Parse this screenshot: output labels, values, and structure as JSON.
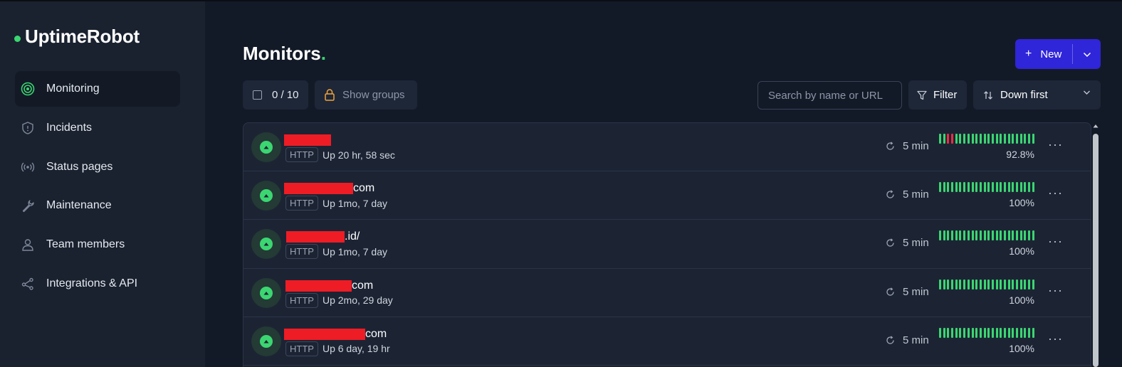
{
  "app": {
    "name": "UptimeRobot",
    "brand_color": "#3bd671",
    "accent": "#2f25d9",
    "down_color": "#ee2b44"
  },
  "sidebar": {
    "items": [
      {
        "label": "Monitoring",
        "icon": "target-icon",
        "active": true
      },
      {
        "label": "Incidents",
        "icon": "shield-alert-icon"
      },
      {
        "label": "Status pages",
        "icon": "broadcast-icon"
      },
      {
        "label": "Maintenance",
        "icon": "wrench-icon"
      },
      {
        "label": "Team members",
        "icon": "user-icon"
      },
      {
        "label": "Integrations & API",
        "icon": "share-nodes-icon"
      }
    ]
  },
  "header": {
    "title": "Monitors",
    "title_dot": ".",
    "new_label": "New"
  },
  "toolbar": {
    "selected_count": "0 / 10",
    "show_groups_label": "Show groups",
    "search_placeholder": "Search by name or URL",
    "filter_label": "Filter",
    "sort_label": "Down first"
  },
  "monitors": [
    {
      "name_suffix": "",
      "type": "HTTP",
      "status_text": "Up 20 hr, 58 sec",
      "interval": "5 min",
      "uptime": "92.8%",
      "down_bars": [
        2,
        3
      ]
    },
    {
      "name_suffix": "com",
      "type": "HTTP",
      "status_text": "Up 1mo, 7 day",
      "interval": "5 min",
      "uptime": "100%",
      "down_bars": []
    },
    {
      "name_suffix": ".id/",
      "type": "HTTP",
      "status_text": "Up 1mo, 7 day",
      "interval": "5 min",
      "uptime": "100%",
      "down_bars": []
    },
    {
      "name_suffix": "com",
      "type": "HTTP",
      "status_text": "Up 2mo, 29 day",
      "interval": "5 min",
      "uptime": "100%",
      "down_bars": []
    },
    {
      "name_suffix": "com",
      "type": "HTTP",
      "status_text": "Up 6 day, 19 hr",
      "interval": "5 min",
      "uptime": "100%",
      "down_bars": []
    }
  ]
}
